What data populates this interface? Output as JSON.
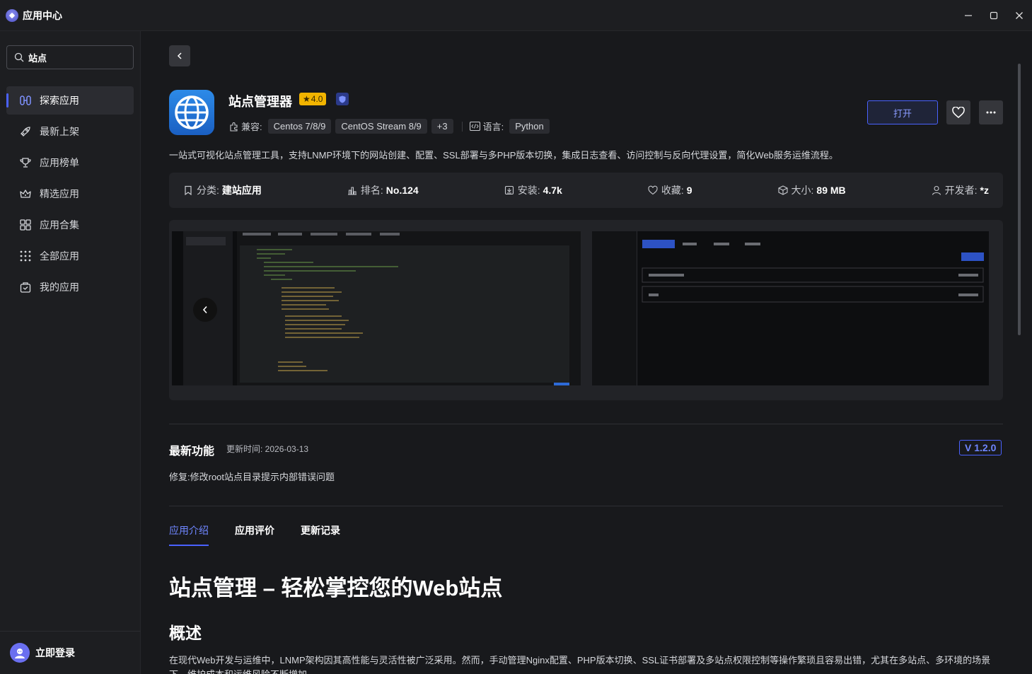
{
  "window": {
    "title": "应用中心"
  },
  "sidebar": {
    "search_value": "站点",
    "items": [
      {
        "label": "探索应用",
        "icon": "explore-icon",
        "active": true
      },
      {
        "label": "最新上架",
        "icon": "rocket-icon"
      },
      {
        "label": "应用榜单",
        "icon": "trophy-icon"
      },
      {
        "label": "精选应用",
        "icon": "crown-icon"
      },
      {
        "label": "应用合集",
        "icon": "grid-icon"
      },
      {
        "label": "全部应用",
        "icon": "dots-grid-icon"
      },
      {
        "label": "我的应用",
        "icon": "bag-icon"
      }
    ],
    "login_label": "立即登录"
  },
  "app": {
    "name": "站点管理器",
    "rating": "4.0",
    "compat_label": "兼容:",
    "compat": [
      "Centos 7/8/9",
      "CentOS Stream 8/9",
      "+3"
    ],
    "lang_label": "语言:",
    "lang": "Python",
    "open_label": "打开",
    "description": "一站式可视化站点管理工具，支持LNMP环境下的网站创建、配置、SSL部署与多PHP版本切换，集成日志查看、访问控制与反向代理设置，简化Web服务运维流程。"
  },
  "stats": {
    "category_label": "分类:",
    "category": "建站应用",
    "rank_label": "排名:",
    "rank": "No.124",
    "install_label": "安装:",
    "install": "4.7k",
    "fav_label": "收藏:",
    "fav": "9",
    "size_label": "大小:",
    "size": "89 MB",
    "dev_label": "开发者:",
    "dev": "*z"
  },
  "update": {
    "title": "最新功能",
    "time": "更新时间: 2026-03-13",
    "version": "V 1.2.0",
    "notes": "修复:修改root站点目录提示内部错误问题"
  },
  "tabs": [
    "应用介绍",
    "应用评价",
    "更新记录"
  ],
  "content": {
    "h1": "站点管理 – 轻松掌控您的Web站点",
    "h2": "概述",
    "para": "在现代Web开发与运维中，LNMP架构因其高性能与灵活性被广泛采用。然而，手动管理Nginx配置、PHP版本切换、SSL证书部署及多站点权限控制等操作繁琐且容易出错，尤其在多站点、多环境的场景下，维护成本和运维风险不断增加。"
  }
}
